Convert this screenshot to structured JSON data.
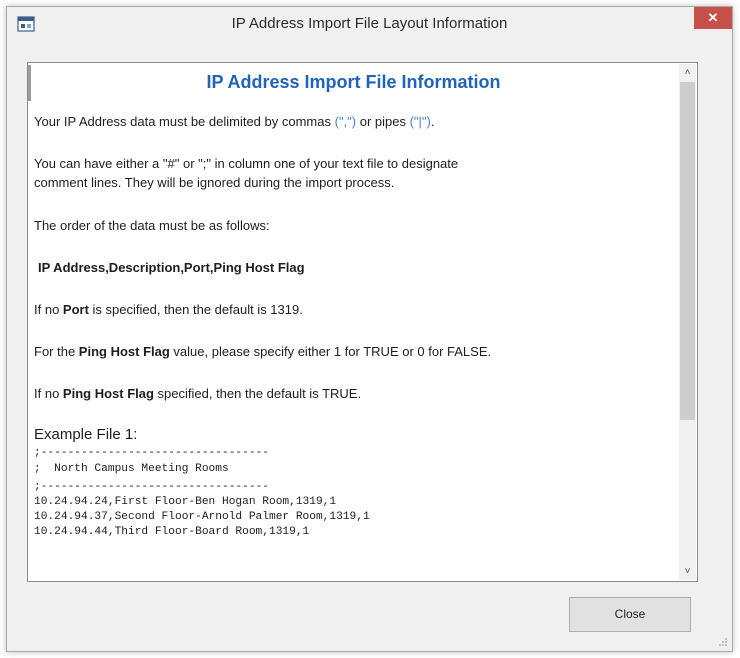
{
  "window": {
    "title": "IP Address Import File Layout Information",
    "close_glyph": "✕",
    "icon": "app-window-icon"
  },
  "content": {
    "heading": "IP Address Import File Information",
    "delim_prefix": "Your IP Address data must be delimited by commas ",
    "delim_comma": "(\",\")",
    "delim_mid": " or pipes ",
    "delim_pipe": "(\"|\")",
    "delim_end": ".",
    "comment_line1": "You can have either a \"#\" or \";\" in column one of your text file to designate",
    "comment_line2": "comment lines. They will be ignored during the import process.",
    "order_intro": "The order of the data must be as follows:",
    "order_fields": "IP Address,Description,Port,Ping Host Flag",
    "port_prefix": "If no ",
    "port_bold": "Port",
    "port_suffix": " is specified, then the default is 1319.",
    "flag_prefix": "For the ",
    "flag_bold": "Ping Host Flag",
    "flag_suffix": " value, please specify either 1 for TRUE or 0 for FALSE.",
    "noflag_prefix": "If no ",
    "noflag_bold": "Ping Host Flag",
    "noflag_suffix": " specified, then the default is TRUE.",
    "example_title": "Example File 1:",
    "code_lines": [
      ";----------------------------------",
      ";  North Campus Meeting Rooms",
      ";----------------------------------",
      "10.24.94.24,First Floor-Ben Hogan Room,1319,1",
      "10.24.94.37,Second Floor-Arnold Palmer Room,1319,1",
      "10.24.94.44,Third Floor-Board Room,1319,1"
    ]
  },
  "scrollbar": {
    "up": "˄",
    "down": "˅"
  },
  "buttons": {
    "close_label": "Close"
  },
  "colors": {
    "heading": "#1f64b6",
    "quote": "#4b7fd4",
    "close_x_bg": "#c7504b"
  }
}
